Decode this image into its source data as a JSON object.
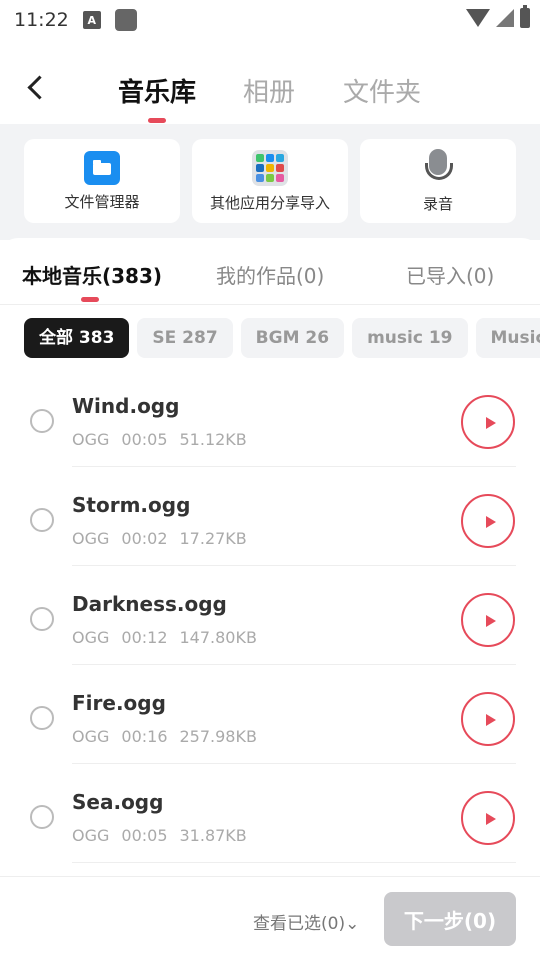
{
  "status_bar": {
    "time": "11:22",
    "a_icon": "A"
  },
  "header": {
    "tabs": [
      {
        "label": "音乐库"
      },
      {
        "label": "相册"
      },
      {
        "label": "文件夹"
      }
    ]
  },
  "import_sources": [
    {
      "label": "文件管理器",
      "icon": "folder-icon"
    },
    {
      "label": "其他应用分享导入",
      "icon": "apps-icon"
    },
    {
      "label": "录音",
      "icon": "microphone-icon"
    }
  ],
  "sub_tabs": [
    {
      "label": "本地音乐(383)"
    },
    {
      "label": "我的作品(0)"
    },
    {
      "label": "已导入(0)"
    }
  ],
  "filters": [
    {
      "label": "全部 383"
    },
    {
      "label": "SE 287"
    },
    {
      "label": "BGM 26"
    },
    {
      "label": "music 19"
    },
    {
      "label": "Music"
    }
  ],
  "files": [
    {
      "name": "Wind.ogg",
      "format": "OGG",
      "duration": "00:05",
      "size": "51.12KB"
    },
    {
      "name": "Storm.ogg",
      "format": "OGG",
      "duration": "00:02",
      "size": "17.27KB"
    },
    {
      "name": "Darkness.ogg",
      "format": "OGG",
      "duration": "00:12",
      "size": "147.80KB"
    },
    {
      "name": "Fire.ogg",
      "format": "OGG",
      "duration": "00:16",
      "size": "257.98KB"
    },
    {
      "name": "Sea.ogg",
      "format": "OGG",
      "duration": "00:05",
      "size": "31.87KB"
    }
  ],
  "bottom": {
    "view_selected": "查看已选(0)⌄",
    "next_label": "下一步(0)"
  },
  "colors": {
    "accent": "#e64a5a",
    "chip_active": "#1a1a1a",
    "folder_blue": "#1a8ef0"
  }
}
